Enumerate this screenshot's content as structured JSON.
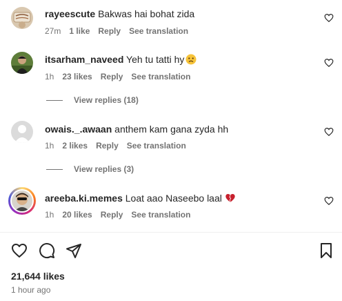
{
  "comments": [
    {
      "username": "rayeescute",
      "text": "Bakwas hai bohat zida",
      "time": "27m",
      "likes": "1 like",
      "reply": "Reply",
      "translate": "See translation"
    },
    {
      "username": "itsarham_naveed",
      "text": "Yeh tu tatti hy",
      "time": "1h",
      "likes": "23 likes",
      "reply": "Reply",
      "translate": "See translation",
      "view_replies": "View replies (18)"
    },
    {
      "username": "owais._.awaan",
      "text": "anthem kam gana zyda hh",
      "time": "1h",
      "likes": "2 likes",
      "reply": "Reply",
      "translate": "See translation",
      "view_replies": "View replies (3)"
    },
    {
      "username": "areeba.ki.memes",
      "text": "Loat aao Naseebo laal",
      "time": "1h",
      "likes": "20 likes",
      "reply": "Reply",
      "translate": "See translation"
    }
  ],
  "post": {
    "likes_count": "21,644 likes",
    "posted_ago": "1 hour ago"
  },
  "icons": {
    "like": "heart-outline-icon",
    "comment": "speech-bubble-icon",
    "share": "paper-plane-icon",
    "save": "bookmark-icon"
  },
  "colors": {
    "text_primary": "#262626",
    "text_secondary": "#737373",
    "heart_red": "#c7202d"
  }
}
